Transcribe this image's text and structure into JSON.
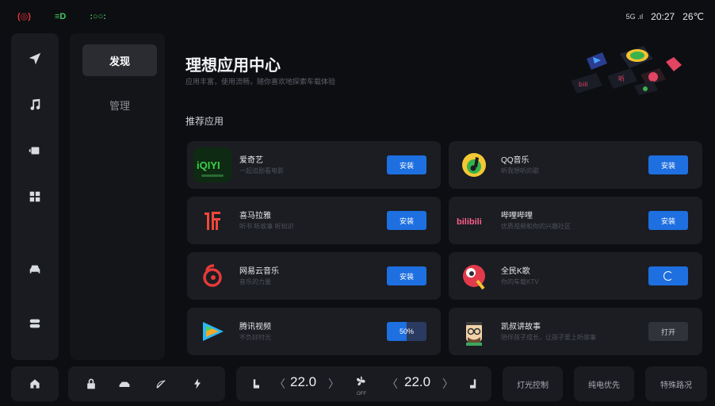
{
  "status": {
    "left_icons": [
      "hazard-icon",
      "low-beam-icon",
      "position-light-icon"
    ],
    "network": "5G",
    "time": "20:27",
    "temperature": "26℃"
  },
  "rail": {
    "items": [
      "navigation-icon",
      "music-icon",
      "video-icon",
      "apps-icon",
      "car-icon",
      "settings-toggle-icon"
    ]
  },
  "subnav": {
    "items": [
      {
        "label": "发现",
        "active": true
      },
      {
        "label": "管理",
        "active": false
      }
    ]
  },
  "main": {
    "title": "理想应用中心",
    "subtitle": "应用丰富，使用流畅，随你喜欢地探索车载体验",
    "section": "推荐应用"
  },
  "apps": [
    {
      "name": "爱奇艺",
      "desc": "一起追剧看电影",
      "action": "安装",
      "state": "install",
      "icon": "iqiyi-icon"
    },
    {
      "name": "QQ音乐",
      "desc": "听我想听的歌",
      "action": "安装",
      "state": "install",
      "icon": "qq-music-icon"
    },
    {
      "name": "喜马拉雅",
      "desc": "听书 听故事 听知识",
      "action": "安装",
      "state": "install",
      "icon": "ximalaya-icon"
    },
    {
      "name": "哔哩哔哩",
      "desc": "优质视频和你的兴趣社区",
      "action": "安装",
      "state": "install",
      "icon": "bilibili-icon"
    },
    {
      "name": "网易云音乐",
      "desc": "音乐的力量",
      "action": "安装",
      "state": "install",
      "icon": "netease-music-icon"
    },
    {
      "name": "全民K歌",
      "desc": "你的车载KTV",
      "action": "",
      "state": "loading",
      "icon": "kge-icon"
    },
    {
      "name": "腾讯视频",
      "desc": "不负好时光",
      "action": "50%",
      "state": "progress",
      "progress": 0.5,
      "icon": "tencent-video-icon"
    },
    {
      "name": "凯叔讲故事",
      "desc": "陪伴孩子成长，让孩子爱上听故事",
      "action": "打开",
      "state": "open",
      "icon": "kaishu-icon"
    }
  ],
  "bottom": {
    "temp_left": "22.0",
    "temp_right": "22.0",
    "fan_label": "OFF",
    "buttons": [
      "灯光控制",
      "纯电优先",
      "特殊路况"
    ]
  },
  "colors": {
    "accent": "#1e6fe0",
    "background": "#0d0e12",
    "card": "#1b1d22",
    "hazard": "#e0353d",
    "light": "#41c95d"
  }
}
